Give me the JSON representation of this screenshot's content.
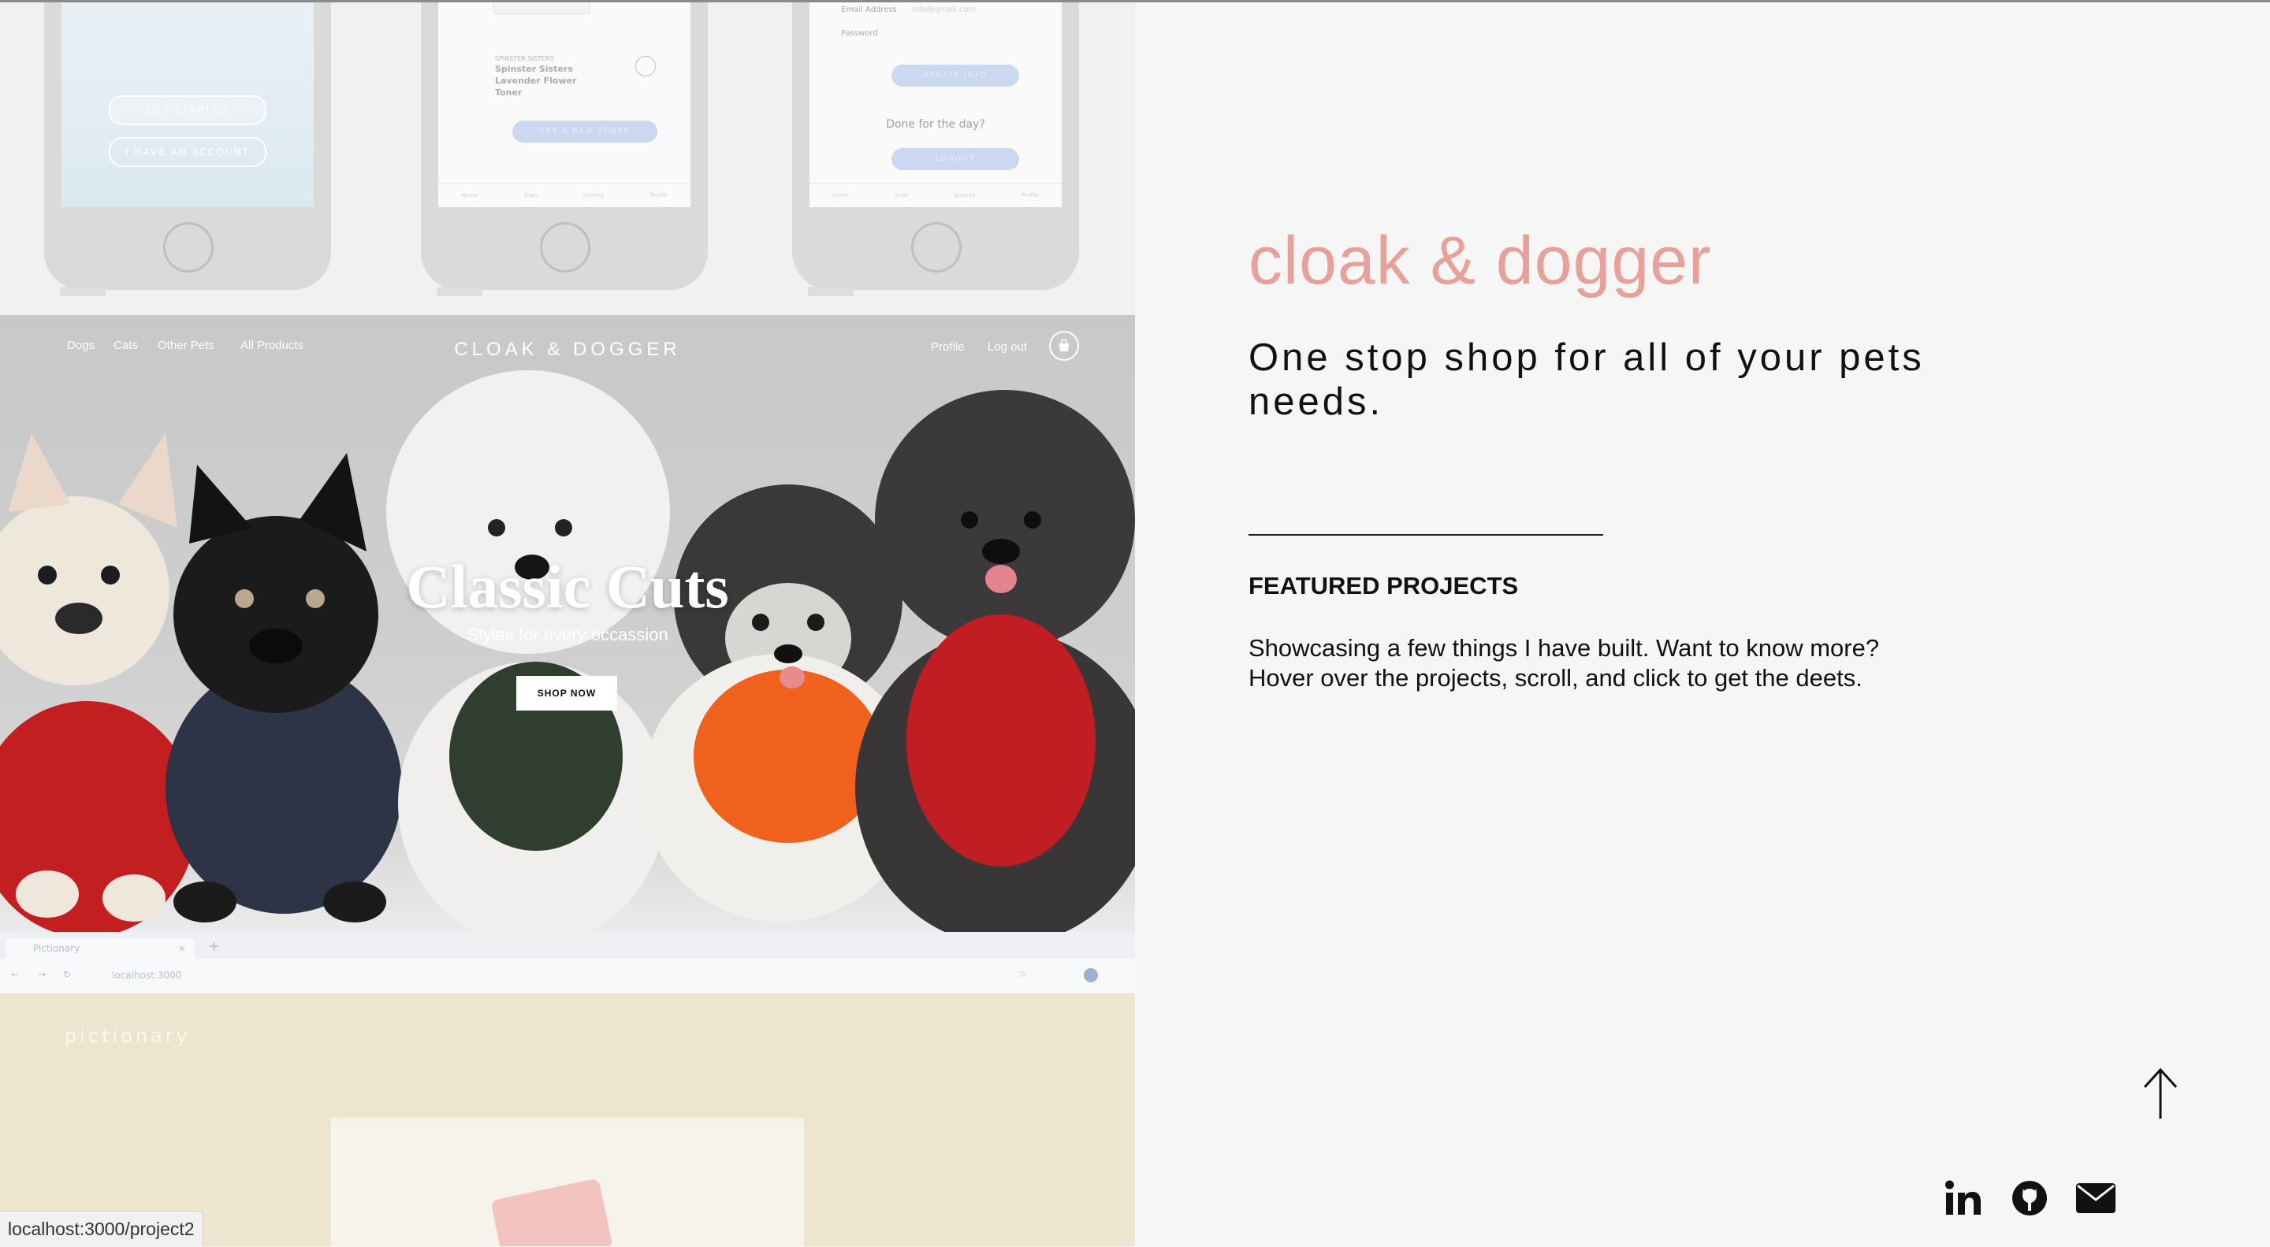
{
  "phones": {
    "left": {
      "button_primary": "GET STARTED",
      "button_secondary": "I HAVE AN ACCOUNT"
    },
    "middle": {
      "brand": "SPINSTER SISTERS",
      "product": "Spinster Sisters Lavender Flower Toner",
      "button": "GET A NEW TONER"
    },
    "right": {
      "email_label": "Email Address",
      "email_placeholder": "info@gmail.com",
      "password_label": "Password",
      "update_button": "UPDATE INFO",
      "done_text": "Done for the day?",
      "logout_button": "LOGOUT"
    },
    "tab_labels": [
      "Home",
      "Scan",
      "Journey",
      "Profile"
    ]
  },
  "hero": {
    "nav": [
      "Dogs",
      "Cats",
      "Other Pets",
      "All Products"
    ],
    "brand": "CLOAK & DOGGER",
    "profile": "Profile",
    "logout": "Log out",
    "title": "Classic Cuts",
    "subtitle": "Styles for every occassion",
    "cta": "SHOP NOW"
  },
  "browser_preview": {
    "tab_title": "Pictionary",
    "url": "localhost:3000",
    "logo": "pictionary"
  },
  "status_url": "localhost:3000/project2",
  "project": {
    "title": "cloak & dogger",
    "tagline": "One stop shop for all of your pets needs.",
    "section_heading": "FEATURED PROJECTS",
    "description": "Showcasing a few things I have built. Want to know more? Hover over the projects, scroll, and click to get the deets.",
    "accent_color": "#e8a09a"
  },
  "icons": {
    "scroll_top": "arrow-up-icon",
    "social": [
      "linkedin-icon",
      "github-icon",
      "mail-icon"
    ]
  }
}
